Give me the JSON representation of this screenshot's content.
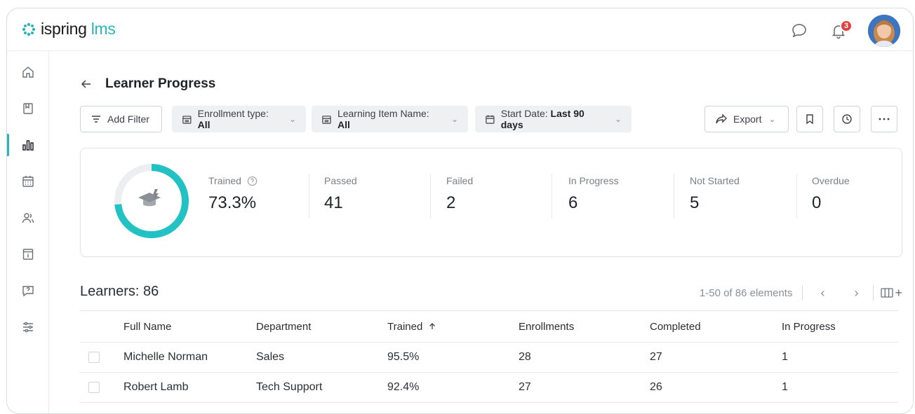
{
  "app": {
    "logo_main": "ispring",
    "logo_accent": "lms"
  },
  "header": {
    "notifications_count": "3"
  },
  "sidebar": {
    "items": [
      {
        "name": "home-icon",
        "active": false
      },
      {
        "name": "book-icon",
        "active": false
      },
      {
        "name": "reports-icon",
        "active": true
      },
      {
        "name": "calendar-icon",
        "active": false
      },
      {
        "name": "users-icon",
        "active": false
      },
      {
        "name": "info-icon",
        "active": false
      },
      {
        "name": "help-icon",
        "active": false
      },
      {
        "name": "settings-sliders-icon",
        "active": false
      }
    ]
  },
  "page": {
    "title": "Learner Progress"
  },
  "filters": {
    "add_filter": "Add Filter",
    "enrollment_label": "Enrollment type:",
    "enrollment_value": "All",
    "learning_item_label": "Learning Item Name:",
    "learning_item_value": "All",
    "start_date_label": "Start Date:",
    "start_date_value": "Last 90 days",
    "export": "Export"
  },
  "stats": {
    "trained_fraction": 0.733,
    "colors": {
      "accent": "#22c1c3",
      "track": "#eceef0"
    },
    "items": [
      {
        "label": "Trained",
        "value": "73.3%"
      },
      {
        "label": "Passed",
        "value": "41"
      },
      {
        "label": "Failed",
        "value": "2"
      },
      {
        "label": "In Progress",
        "value": "6"
      },
      {
        "label": "Not Started",
        "value": "5"
      },
      {
        "label": "Overdue",
        "value": "0"
      }
    ]
  },
  "learners": {
    "title": "Learners: 86",
    "pagination": "1-50 of 86 elements"
  },
  "table": {
    "columns": [
      "Full Name",
      "Department",
      "Trained",
      "Enrollments",
      "Completed",
      "In Progress"
    ],
    "rows": [
      [
        "Michelle Norman",
        "Sales",
        "95.5%",
        "28",
        "27",
        "1"
      ],
      [
        "Robert Lamb",
        "Tech Support",
        "92.4%",
        "27",
        "26",
        "1"
      ]
    ]
  }
}
